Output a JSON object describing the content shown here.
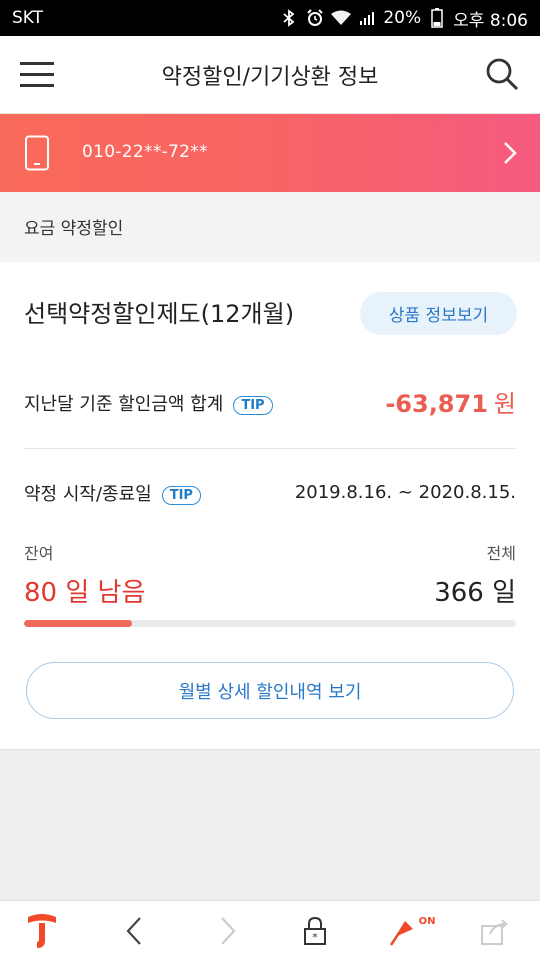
{
  "status_bar": {
    "carrier": "SKT",
    "battery": "20%",
    "time": "오후 8:06"
  },
  "header": {
    "title": "약정할인/기기상환 정보",
    "menu_icon": "hamburger-menu-icon",
    "search_icon": "search-icon"
  },
  "phone": {
    "number": "010-22**-72**"
  },
  "section": {
    "label": "요금 약정할인"
  },
  "plan": {
    "title": "선택약정할인제도(12개월)",
    "info_button": "상품 정보보기",
    "discount_label": "지난달 기준 할인금액 합계",
    "tip": "TIP",
    "discount_value": "-63,871",
    "discount_unit": "원",
    "period_label": "약정 시작/종료일",
    "period_value": "2019.8.16. ~ 2020.8.15.",
    "remaining_label": "잔여",
    "remaining_value": "80 일 남음",
    "total_label": "전체",
    "total_value": "366 일",
    "progress_fraction": 0.22,
    "history_button": "월별 상세 할인내역 보기"
  },
  "bottom_bar": {
    "pin_badge": "ON"
  },
  "colors": {
    "accent_red": "#e0392f",
    "banner_start": "#f96b59",
    "banner_end": "#f55a80",
    "link_blue": "#2a78c8"
  }
}
